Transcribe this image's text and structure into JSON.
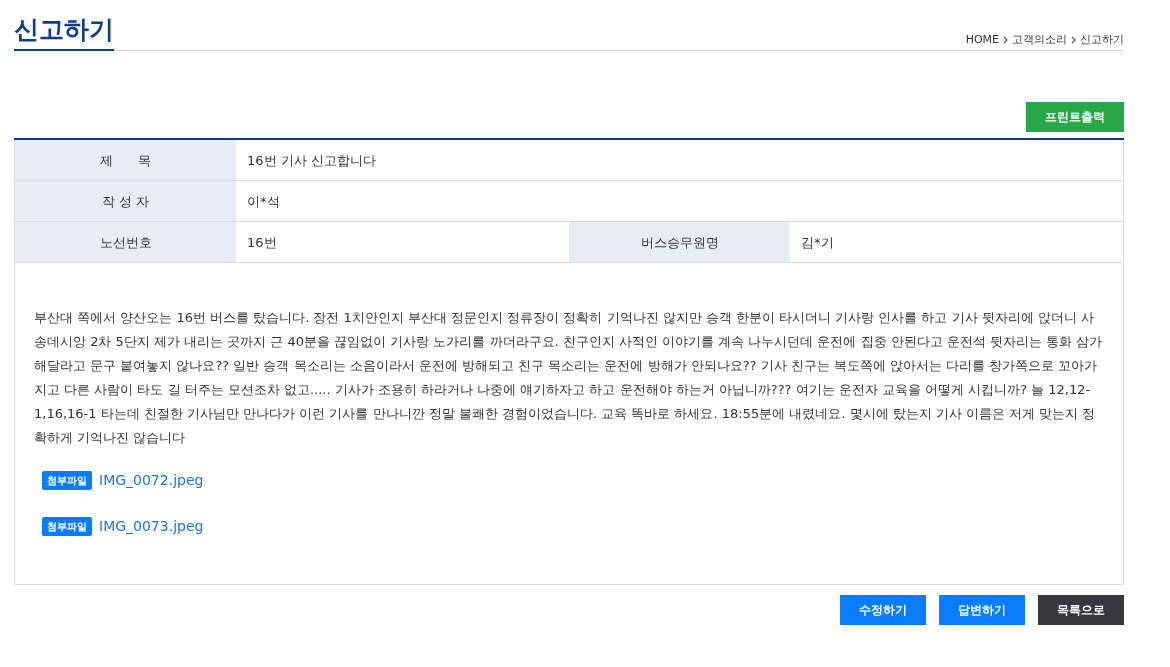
{
  "page_title": "신고하기",
  "breadcrumb": [
    "HOME",
    "고객의소리",
    "신고하기"
  ],
  "print_button": "프린트출력",
  "rows": [
    [
      {
        "label": "제      목",
        "value": "16번 기사 신고합니다"
      }
    ],
    [
      {
        "label": "작 성 자",
        "value": "이*석"
      }
    ],
    [
      {
        "label": "노선번호",
        "value": "16번"
      },
      {
        "label": "버스승무원명",
        "value": "김*기"
      }
    ]
  ],
  "body": "부산대 쪽에서 양산오는 16번 버스를 탔습니다. 장전 1치안인지 부산대 정문인지 정류장이 정확히 기억나진 않지만 승객 한분이 타시더니 기사랑 인사를 하고 기사 뒷자리에 앉더니 사송데시앙 2차 5단지 제가 내리는 곳까지 근 40분을 끊임없이 기사랑 노가리를 까더라구요. 친구인지 사적인 이야기를 계속 나누시던데 운전에 집중 안된다고 운전석 뒷자리는 통화 삼가해달라고 문구 붙여놓지 않나요?? 일반 승객 목소리는 소음이라서 운전에 방해되고 친구 목소리는 운전에 방해가 안되나요?? 기사 친구는 복도쪽에 앉아서는 다리를 창가쪽으로 꼬아가지고 다른 사람이 타도 길 터주는 모션조차 없고..... 기사가 조용히 하라거나 나중에 얘기하자고 하고 운전해야 하는거 아닙니까??? 여기는 운전자 교육을 어떻게 시킵니까? 늘 12,12-1,16,16-1 타는데 친절한 기사님만 만나다가 이런 기사를 만나니깐 정말 불쾌한 경험이었습니다. 교육 똑바로 하세요. 18:55분에 내렸네요. 몇시에 탔는지 기사 이름은 저게 맞는지 정확하게 기억나진 않습니다",
  "attachments": [
    {
      "badge": "첨부파일",
      "file": "IMG_0072.jpeg"
    },
    {
      "badge": "첨부파일",
      "file": "IMG_0073.jpeg"
    }
  ],
  "actions": [
    {
      "label": "수정하기",
      "kind": "primary"
    },
    {
      "label": "답변하기",
      "kind": "primary"
    },
    {
      "label": "목록으로",
      "kind": "dark"
    }
  ]
}
